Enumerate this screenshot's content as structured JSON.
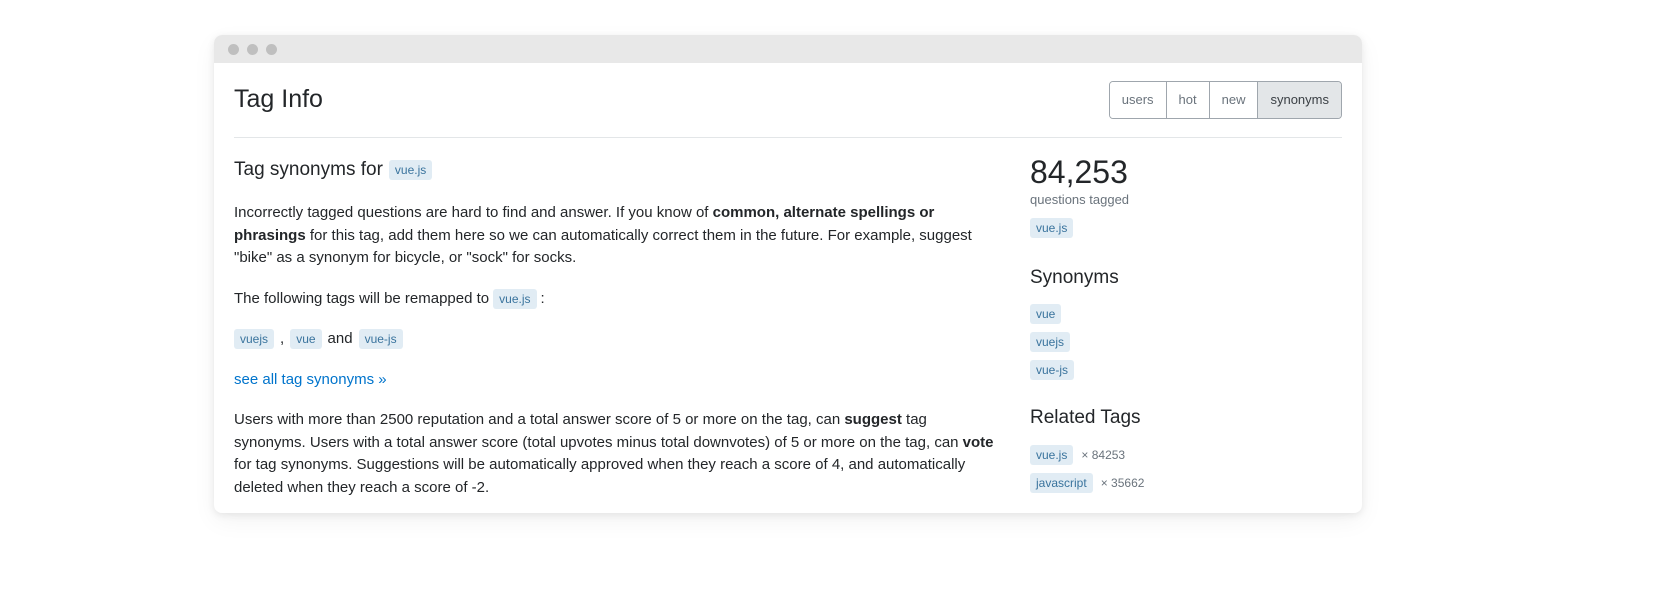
{
  "header": {
    "title": "Tag Info",
    "tabs": [
      "users",
      "hot",
      "new",
      "synonyms"
    ],
    "active_tab": "synonyms"
  },
  "main": {
    "subheader_prefix": "Tag synonyms for",
    "subject_tag": "vue.js",
    "intro_part1": "Incorrectly tagged questions are hard to find and answer. If you know of ",
    "intro_bold1": "common, alternate spellings or phrasings",
    "intro_part2": " for this tag, add them here so we can automatically correct them in the future. For example, suggest \"bike\" as a synonym for bicycle, or \"sock\" for socks.",
    "remap_text": "The following tags will be remapped to ",
    "remap_tag": "vue.js",
    "remap_colon": " :",
    "remap_chips": [
      "vuejs",
      "vue",
      "vue-js"
    ],
    "comma": ",",
    "and": "and",
    "see_all_link": "see all tag synonyms »",
    "bottom_part1": "Users with more than 2500 reputation and a total answer score of 5 or more on the tag, can ",
    "bottom_bold1": "suggest",
    "bottom_part2": " tag synonyms. Users with a total answer score (total upvotes minus total downvotes) of 5 or more on the tag, can ",
    "bottom_bold2": "vote",
    "bottom_part3": " for tag synonyms. Suggestions will be automatically approved when they reach a score of 4, and automatically deleted when they reach a score of -2."
  },
  "sidebar": {
    "count": "84,253",
    "count_label": "questions tagged",
    "count_tag": "vue.js",
    "synonyms_title": "Synonyms",
    "synonyms": [
      "vue",
      "vuejs",
      "vue-js"
    ],
    "related_title": "Related Tags",
    "related": [
      {
        "tag": "vue.js",
        "count": "84253"
      },
      {
        "tag": "javascript",
        "count": "35662"
      }
    ],
    "times": "×"
  }
}
